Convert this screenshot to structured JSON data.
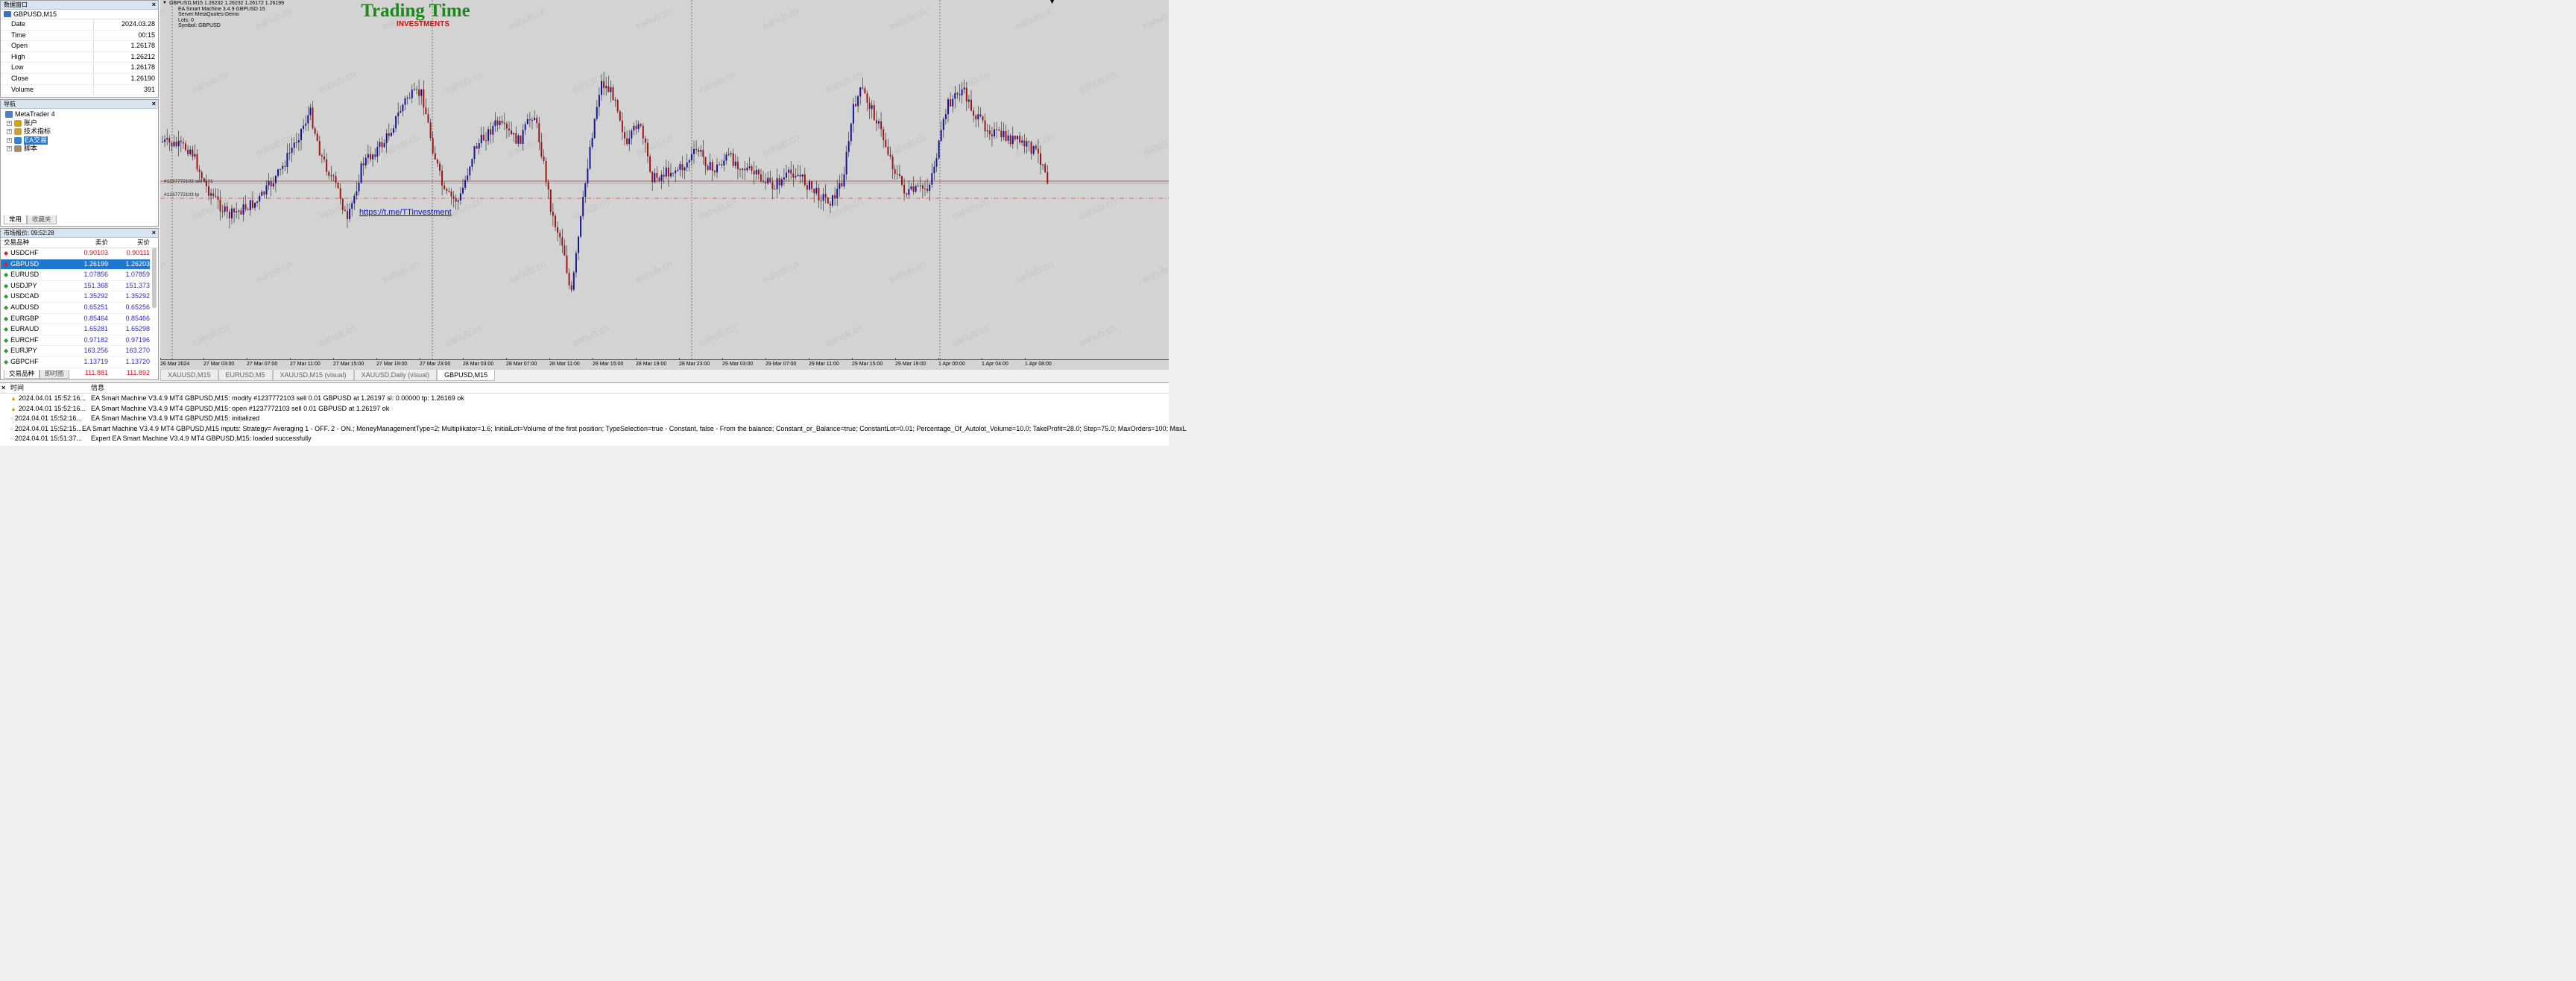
{
  "data_window": {
    "title": "数据窗口",
    "symbol": "GBPUSD,M15",
    "rows": [
      {
        "k": "Date",
        "v": "2024.03.28"
      },
      {
        "k": "Time",
        "v": "00:15"
      },
      {
        "k": "Open",
        "v": "1.26178"
      },
      {
        "k": "High",
        "v": "1.26212"
      },
      {
        "k": "Low",
        "v": "1.26178"
      },
      {
        "k": "Close",
        "v": "1.26190"
      },
      {
        "k": "Volume",
        "v": "391"
      }
    ]
  },
  "navigator": {
    "title": "导航",
    "root": "MetaTrader 4",
    "items": [
      {
        "label": "账户",
        "icon": "accounts-icon"
      },
      {
        "label": "技术指标",
        "icon": "indicators-icon"
      },
      {
        "label": "EA交易",
        "icon": "expert-advisors-icon"
      },
      {
        "label": "脚本",
        "icon": "scripts-icon"
      }
    ],
    "tabs": [
      "常用",
      "收藏夹"
    ]
  },
  "market_watch": {
    "title": "市场报价: 09:52:28",
    "headers": [
      "交易品种",
      "卖价",
      "买价"
    ],
    "rows": [
      {
        "sym": "USDCHF",
        "bid": "0.90103",
        "ask": "0.90111",
        "dir": "down"
      },
      {
        "sym": "GBPUSD",
        "bid": "1.26199",
        "ask": "1.26203",
        "dir": "down",
        "selected": true
      },
      {
        "sym": "EURUSD",
        "bid": "1.07856",
        "ask": "1.07859",
        "dir": "up"
      },
      {
        "sym": "USDJPY",
        "bid": "151.368",
        "ask": "151.373",
        "dir": "up"
      },
      {
        "sym": "USDCAD",
        "bid": "1.35292",
        "ask": "1.35292",
        "dir": "up"
      },
      {
        "sym": "AUDUSD",
        "bid": "0.65251",
        "ask": "0.65256",
        "dir": "up"
      },
      {
        "sym": "EURGBP",
        "bid": "0.85464",
        "ask": "0.85466",
        "dir": "up"
      },
      {
        "sym": "EURAUD",
        "bid": "1.65281",
        "ask": "1.65298",
        "dir": "up"
      },
      {
        "sym": "EURCHF",
        "bid": "0.97182",
        "ask": "0.97196",
        "dir": "up"
      },
      {
        "sym": "EURJPY",
        "bid": "163.256",
        "ask": "163.270",
        "dir": "up"
      },
      {
        "sym": "GBPCHF",
        "bid": "1.13719",
        "ask": "1.13720",
        "dir": "up"
      },
      {
        "sym": "CADJPY",
        "bid": "111.881",
        "ask": "111.892",
        "dir": "down"
      }
    ],
    "tabs": [
      "交易品种",
      "即时图"
    ],
    "colors": {
      "up": "#2b2bd0",
      "down": "#e01010"
    }
  },
  "chart": {
    "info_lines": [
      "GBPUSD,M15  1.26232 1.26232 1.26172 1.26199",
      "EA Smart Machine 3.4.9  GBPUSD  15",
      "Server:MetaQuotes-Demo",
      "Lots:  0",
      "Symbol: GBPUSD"
    ],
    "logo_title": "Trading Time",
    "logo_sub": "INVESTMENTS",
    "link": "https://t.me/TTinvestment",
    "order_label": "#1237772103 sell 0.01",
    "tp_label": "#1237772103 tp",
    "watermark": "eahub.cn",
    "time_labels": [
      "26 Mar 2024",
      "27 Mar 03:00",
      "27 Mar 07:00",
      "27 Mar 11:00",
      "27 Mar 15:00",
      "27 Mar 19:00",
      "27 Mar 23:00",
      "28 Mar 03:00",
      "28 Mar 07:00",
      "28 Mar 11:00",
      "28 Mar 15:00",
      "28 Mar 19:00",
      "28 Mar 23:00",
      "29 Mar 03:00",
      "29 Mar 07:00",
      "29 Mar 11:00",
      "29 Mar 15:00",
      "29 Mar 19:00",
      "1 Apr 00:00",
      "1 Apr 04:00",
      "1 Apr 08:00"
    ],
    "colors": {
      "bg": "#d3d3d3",
      "bull": "#1414a0",
      "bear": "#a01414",
      "wick": "#202020",
      "logo": "#1a8a1a",
      "sub": "#cc1010",
      "link": "#1010cc",
      "order": "#b03030",
      "tp": "#e04040"
    }
  },
  "chart_tabs": [
    "XAUUSD,M15",
    "EURUSD,M5",
    "XAUUSD,M15 (visual)",
    "XAUUSD,Daily (visual)",
    "GBPUSD,M15"
  ],
  "terminal": {
    "headers": [
      "时间",
      "信息"
    ],
    "rows": [
      {
        "time": "2024.04.01 15:52:16...",
        "msg": "EA Smart Machine V3.4.9 MT4 GBPUSD,M15: modify #1237772103 sell 0.01 GBPUSD at 1.26197 sl: 0.00000 tp: 1.26169 ok",
        "icon": "warning-icon"
      },
      {
        "time": "2024.04.01 15:52:16...",
        "msg": "EA Smart Machine V3.4.9 MT4 GBPUSD,M15: open #1237772103 sell 0.01 GBPUSD at 1.26197 ok",
        "icon": "warning-icon"
      },
      {
        "time": "2024.04.01 15:52:16...",
        "msg": "EA Smart Machine V3.4.9 MT4 GBPUSD,M15: initialized",
        "icon": "info-icon"
      },
      {
        "time": "2024.04.01 15:52:15...",
        "msg": "EA Smart Machine V3.4.9 MT4 GBPUSD,M15 inputs: Strategy= Averaging 1 - OFF. 2 - ON.; MoneyManagementType=2; Multiplikator=1.6; InitialLot=Volume of the first position; TypeSelection=true - Constant, false - From the balance; Constant_or_Balance=true; ConstantLot=0.01; Percentage_Of_Autolot_Volume=10.0; TakeProfit=28.0; Step=75.0; MaxOrders=100; MaxL",
        "icon": "info-icon"
      },
      {
        "time": "2024.04.01 15:51:37...",
        "msg": "Expert EA Smart Machine V3.4.9 MT4 GBPUSD,M15: loaded successfully",
        "icon": "info-icon"
      }
    ]
  }
}
